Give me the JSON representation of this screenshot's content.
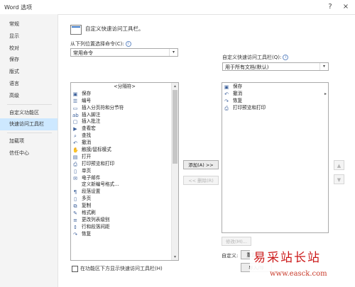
{
  "window": {
    "title": "Word 选项",
    "help_glyph": "?",
    "close_glyph": "×"
  },
  "sidebar": {
    "items": [
      {
        "label": "常规"
      },
      {
        "label": "显示"
      },
      {
        "label": "校对"
      },
      {
        "label": "保存"
      },
      {
        "label": "版式"
      },
      {
        "label": "语言"
      },
      {
        "label": "高级"
      }
    ],
    "items2": [
      {
        "label": "自定义功能区"
      },
      {
        "label": "快速访问工具栏",
        "selected": true
      }
    ],
    "items3": [
      {
        "label": "加载项"
      },
      {
        "label": "信任中心"
      }
    ]
  },
  "header": {
    "title": "自定义快速访问工具栏。"
  },
  "left": {
    "choose_label": "从下列位置选择命令(C):",
    "choose_value": "常用命令",
    "commands": [
      {
        "label": "<分隔符>",
        "icon": "separator",
        "glyph": ""
      },
      {
        "label": "保存",
        "icon": "save-icon",
        "glyph": "▣"
      },
      {
        "label": "编号",
        "icon": "numbering-icon",
        "glyph": "☰",
        "sub": "▸"
      },
      {
        "label": "插入分页符和分节符",
        "icon": "page-break-icon",
        "glyph": "▭",
        "sub": "▸"
      },
      {
        "label": "插入脚注",
        "icon": "footnote-icon",
        "glyph": "ab"
      },
      {
        "label": "插入批注",
        "icon": "comment-icon",
        "glyph": "▢"
      },
      {
        "label": "查看宏",
        "icon": "macro-icon",
        "glyph": "▶"
      },
      {
        "label": "查找",
        "icon": "find-icon",
        "glyph": "⌕"
      },
      {
        "label": "撤消",
        "icon": "undo-icon",
        "glyph": "↶",
        "sub": "▸"
      },
      {
        "label": "触摸/鼠标模式",
        "icon": "touch-icon",
        "glyph": "✋",
        "sub": "▾"
      },
      {
        "label": "打开",
        "icon": "open-icon",
        "glyph": "▤"
      },
      {
        "label": "打印预览和打印",
        "icon": "print-preview-icon",
        "glyph": "⎙"
      },
      {
        "label": "单页",
        "icon": "single-page-icon",
        "glyph": "▯"
      },
      {
        "label": "电子邮件",
        "icon": "email-icon",
        "glyph": "✉"
      },
      {
        "label": "定义新编号格式...",
        "icon": "none",
        "glyph": ""
      },
      {
        "label": "段落设置",
        "icon": "paragraph-icon",
        "glyph": "¶"
      },
      {
        "label": "多页",
        "icon": "multi-page-icon",
        "glyph": "▯"
      },
      {
        "label": "复制",
        "icon": "copy-icon",
        "glyph": "⧉"
      },
      {
        "label": "格式刷",
        "icon": "format-painter-icon",
        "glyph": "✎"
      },
      {
        "label": "更改列表级别",
        "icon": "list-level-icon",
        "glyph": "≡",
        "sub": "▸"
      },
      {
        "label": "行和段落间距",
        "icon": "line-spacing-icon",
        "glyph": "↕",
        "sub": "▸"
      },
      {
        "label": "恢复",
        "icon": "redo-icon",
        "glyph": "↷"
      }
    ],
    "checkbox_label": "在功能区下方显示快速访问工具栏(H)"
  },
  "middle": {
    "add_label": "添加(A) >>",
    "remove_label": "<< 删除(R)"
  },
  "right": {
    "customize_label": "自定义快速访问工具栏(Q):",
    "customize_value": "用于所有文档(默认)",
    "items": [
      {
        "label": "保存",
        "icon": "save-icon",
        "glyph": "▣"
      },
      {
        "label": "撤消",
        "icon": "undo-icon",
        "glyph": "↶",
        "sub": "▸"
      },
      {
        "label": "恢复",
        "icon": "redo-icon",
        "glyph": "↷"
      },
      {
        "label": "打印预览和打印",
        "icon": "print-preview-icon",
        "glyph": "⎙"
      }
    ],
    "modify_label": "修改(M)...",
    "custom_label": "自定义:",
    "reset_label": "重置(E) ▾",
    "import_label": "导入/导⁠",
    "up_glyph": "▲",
    "down_glyph": "▼"
  },
  "watermark": {
    "text": "易采站长站",
    "url": "www.easck.com"
  },
  "colors": {
    "selected_nav": "#cde8ff",
    "accent": "#3d79c6",
    "watermark": "#cc1b1b"
  }
}
